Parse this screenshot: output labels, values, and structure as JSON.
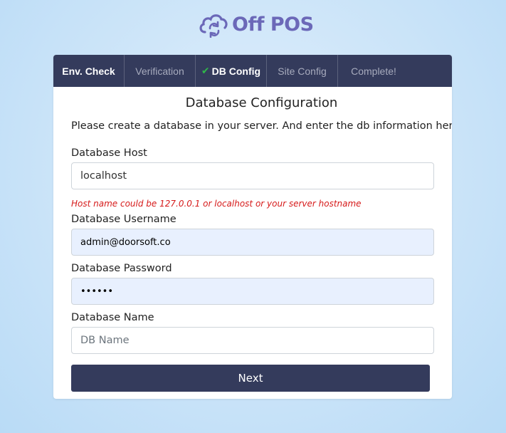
{
  "brand": {
    "name": "Off POS",
    "color": "#6b68b8"
  },
  "tabs": [
    {
      "label": "Env. Check",
      "state": "done"
    },
    {
      "label": "Verification",
      "state": "pending"
    },
    {
      "label": "DB Config",
      "state": "active",
      "icon": "check-icon"
    },
    {
      "label": "Site Config",
      "state": "pending"
    },
    {
      "label": "Complete!",
      "state": "pending"
    }
  ],
  "form": {
    "title": "Database Configuration",
    "intro": "Please create a database in your server. And enter the db information here.",
    "host": {
      "label": "Database Host",
      "value": "localhost",
      "hint": "Host name could be 127.0.0.1 or localhost or your server hostname"
    },
    "username": {
      "label": "Database Username",
      "value": "admin@doorsoft.co"
    },
    "password": {
      "label": "Database Password",
      "value": "••••••"
    },
    "dbname": {
      "label": "Database Name",
      "value": "",
      "placeholder": "DB Name"
    },
    "next_label": "Next"
  },
  "colors": {
    "header_bg": "#343b5c",
    "check": "#2fb64a",
    "hint": "#d61a1a",
    "autofill_bg": "#e8f0fe"
  }
}
